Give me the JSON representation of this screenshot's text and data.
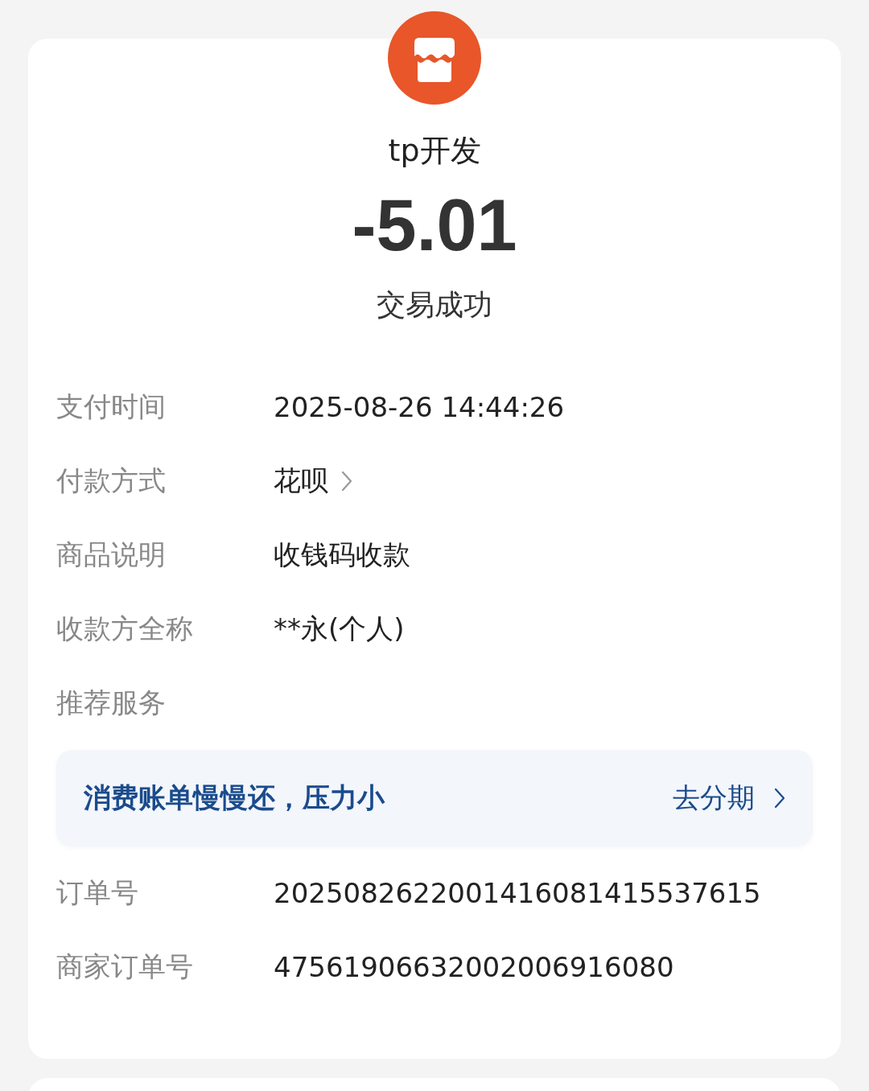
{
  "merchant": {
    "name": "tp开发"
  },
  "amount": "-5.01",
  "status": "交易成功",
  "details": [
    {
      "kind": "plain",
      "label": "支付时间",
      "value": "2025-08-26 14:44:26"
    },
    {
      "kind": "link",
      "label": "付款方式",
      "value": "花呗"
    },
    {
      "kind": "plain",
      "label": "商品说明",
      "value": "收钱码收款"
    },
    {
      "kind": "plain",
      "label": "收款方全称",
      "value": "**永(个人)"
    },
    {
      "kind": "heading",
      "label": "推荐服务"
    }
  ],
  "promo": {
    "text": "消费账单慢慢还，压力小",
    "action": "去分期"
  },
  "order_details": [
    {
      "kind": "plain",
      "label": "订单号",
      "value": "2025082622001416081415537615"
    },
    {
      "kind": "plain",
      "label": "商家订单号",
      "value": "47561906632002006916080"
    }
  ]
}
